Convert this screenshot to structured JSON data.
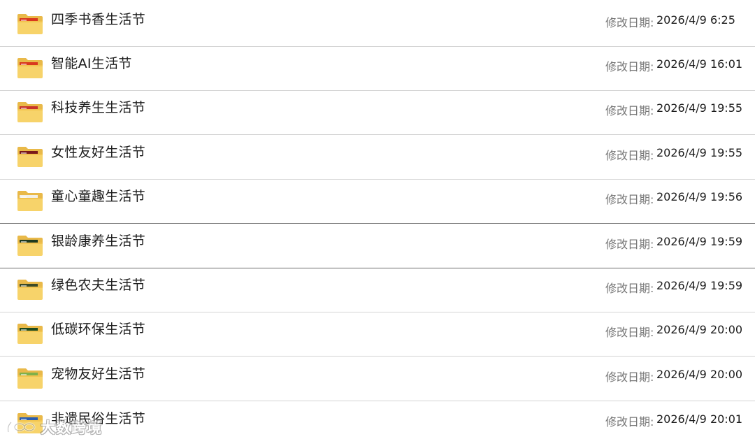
{
  "date_label": "修改日期:",
  "folders": [
    {
      "name": "四季书香生活节",
      "modified": "2026/4/9 6:25",
      "thumb": "#d9381e"
    },
    {
      "name": "智能AI生活节",
      "modified": "2026/4/9 16:01",
      "thumb": "#d9381e"
    },
    {
      "name": "科技养生生活节",
      "modified": "2026/4/9 19:55",
      "thumb": "#c8342a"
    },
    {
      "name": "女性友好生活节",
      "modified": "2026/4/9 19:55",
      "thumb": "#7a1a1a"
    },
    {
      "name": "童心童趣生活节",
      "modified": "2026/4/9 19:56",
      "thumb": "#f3f0e6"
    },
    {
      "name": "银龄康养生活节",
      "modified": "2026/4/9 19:59",
      "thumb": "#1f3a1f"
    },
    {
      "name": "绿色农夫生活节",
      "modified": "2026/4/9 19:59",
      "thumb": "#3b4a28"
    },
    {
      "name": "低碳环保生活节",
      "modified": "2026/4/9 20:00",
      "thumb": "#1d4a1d"
    },
    {
      "name": "宠物友好生活节",
      "modified": "2026/4/9 20:00",
      "thumb": "#7fb04a"
    },
    {
      "name": "非遗民俗生活节",
      "modified": "2026/4/9 20:01",
      "thumb": "#2a5db0"
    }
  ],
  "watermark": {
    "text": "大数跨境",
    "logo": "infinity-eye-logo"
  }
}
